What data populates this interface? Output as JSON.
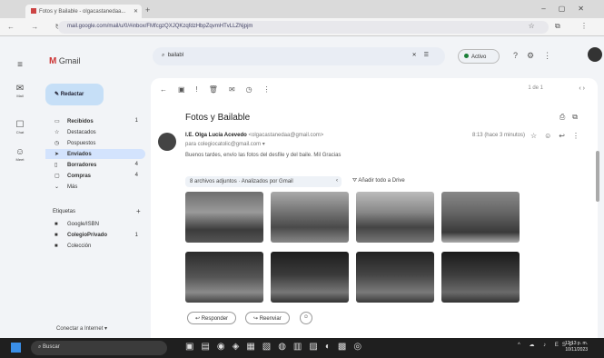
{
  "browser": {
    "tab_title": "Fotos y Bailable - olgacastanedaa...",
    "url": "mail.google.com/mail/u/0/#inbox/FMfcgzQXJQKzqfdzHbpZqvmHTvLLZNjpjm",
    "nav_glyphs": "← → ↻",
    "tool_glyphs": "☆ ⧉ ⋮"
  },
  "gmail": {
    "brand": "Gmail",
    "search_value": "bailabl",
    "status": "Activo",
    "compose_label": "Redactar",
    "rail": [
      {
        "icon": "✉",
        "label": "Mail"
      },
      {
        "icon": "☐",
        "label": "Chat"
      },
      {
        "icon": "☺",
        "label": "Meet"
      }
    ],
    "nav_items": [
      {
        "icon": "▭",
        "label": "Recibidos",
        "count": "1"
      },
      {
        "icon": "☆",
        "label": "Destacados",
        "count": ""
      },
      {
        "icon": "◷",
        "label": "Pospuestos",
        "count": ""
      },
      {
        "icon": "➤",
        "label": "Enviados",
        "count": ""
      },
      {
        "icon": "▯",
        "label": "Borradores",
        "count": "4"
      },
      {
        "icon": "▢",
        "label": "Compras",
        "count": "4"
      },
      {
        "icon": "⌄",
        "label": "Más",
        "count": ""
      }
    ],
    "labels_heading": "Etiquetas",
    "labels": [
      {
        "label": "Google/ISBN",
        "count": ""
      },
      {
        "label": "ColegioPrivado",
        "count": "1"
      },
      {
        "label": "Colección",
        "count": ""
      }
    ],
    "bottom_left": "Conectar a Internet ▾"
  },
  "message": {
    "pager": "1 de 1",
    "subject": "Fotos y Bailable",
    "sender_name": "I.E. Olga Lucía Acevedo",
    "sender_email": "<olgacastanedaa@gmail.com>",
    "to": "para colegiocatolic@gmail.com ▾",
    "date": "8:13 (hace 3 minutos)",
    "body": "Buenos tardes, envío las fotos del desfile y del baile. Mil Gracias",
    "attachments_bar": "8 archivos adjuntos · Analizados por Gmail",
    "drive_label": "Añadir todo a Drive",
    "reply": "Responder",
    "forward": "Reenviar"
  },
  "taskbar": {
    "search": "Buscar",
    "time": "12:13 p. m.",
    "date": "10/11/2023",
    "tray": "ESP"
  }
}
